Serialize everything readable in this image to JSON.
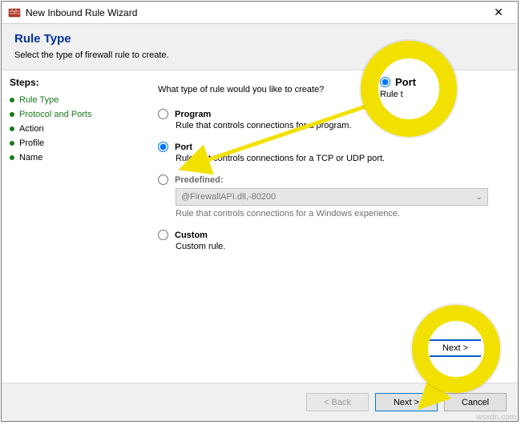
{
  "window": {
    "title": "New Inbound Rule Wizard"
  },
  "header": {
    "title": "Rule Type",
    "subtitle": "Select the type of firewall rule to create."
  },
  "sidebar": {
    "label": "Steps:",
    "items": [
      {
        "label": "Rule Type",
        "active": true
      },
      {
        "label": "Protocol and Ports",
        "active": true
      },
      {
        "label": "Action",
        "active": false
      },
      {
        "label": "Profile",
        "active": false
      },
      {
        "label": "Name",
        "active": false
      }
    ]
  },
  "main": {
    "prompt": "What type of rule would you like to create?",
    "options": [
      {
        "key": "program",
        "label": "Program",
        "desc": "Rule that controls connections for a program.",
        "selected": false,
        "enabled": true
      },
      {
        "key": "port",
        "label": "Port",
        "desc": "Rule that controls connections for a TCP or UDP port.",
        "selected": true,
        "enabled": true
      },
      {
        "key": "predefined",
        "label": "Predefined:",
        "desc": "Rule that controls connections for a Windows experience.",
        "selected": false,
        "enabled": false,
        "dropdown_value": "@FirewallAPI.dll,-80200"
      },
      {
        "key": "custom",
        "label": "Custom",
        "desc": "Custom rule.",
        "selected": false,
        "enabled": true
      }
    ]
  },
  "footer": {
    "back": "< Back",
    "next": "Next >",
    "cancel": "Cancel",
    "back_enabled": false
  },
  "annotations": {
    "callout_port_label": "Port",
    "callout_port_sub": "Rule t",
    "callout_next": "Next >"
  },
  "watermark": "wsxdn.com"
}
